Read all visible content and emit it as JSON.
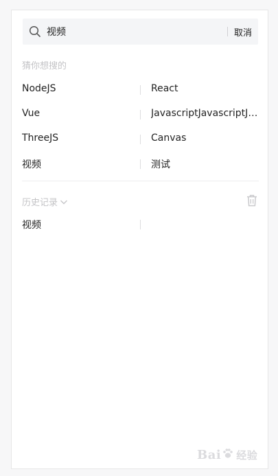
{
  "search": {
    "value": "视频",
    "cancel_label": "取消"
  },
  "suggestions": {
    "title": "猜你想搜的",
    "rows": [
      {
        "left": "NodeJS",
        "right": "React"
      },
      {
        "left": "Vue",
        "right": "JavascriptJavascriptJavascript"
      },
      {
        "left": "ThreeJS",
        "right": "Canvas"
      },
      {
        "left": "视频",
        "right": "测试"
      }
    ]
  },
  "history": {
    "title": "历史记录",
    "items": [
      {
        "left": "视频",
        "right": ""
      }
    ]
  },
  "watermark": {
    "brand_left": "Bai",
    "brand_right": "经验"
  },
  "icons": {
    "search": "search-icon",
    "chevron": "chevron-down-icon",
    "trash": "trash-icon"
  }
}
